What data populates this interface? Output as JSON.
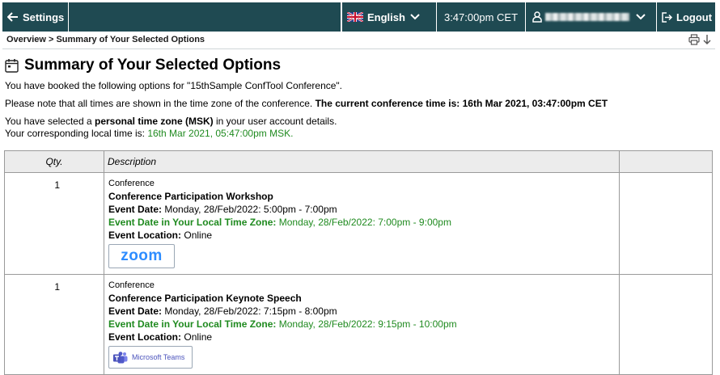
{
  "topbar": {
    "settings_label": "Settings",
    "language_label": "English",
    "time_label": "3:47:00pm CET",
    "logout_label": "Logout"
  },
  "breadcrumb": {
    "text": "Overview > Summary of Your Selected Options"
  },
  "page": {
    "title": "Summary of Your Selected Options",
    "line1": "You have booked the following options for \"15thSample ConfTool Conference\".",
    "line2_prefix": "Please note that all times are shown in the time zone of the conference. ",
    "line2_bold": "The current conference time is: 16th Mar 2021, 03:47:00pm CET",
    "line3_prefix": "You have selected a ",
    "line3_bold": "personal time zone (MSK)",
    "line3_suffix": " in your user account details.",
    "line4_prefix": "Your corresponding local time is: ",
    "line4_value": "16th Mar 2021, 05:47:00pm MSK."
  },
  "table": {
    "headers": [
      "Qty.",
      "Description",
      ""
    ],
    "rows": [
      {
        "qty": "1",
        "category": "Conference",
        "name": "Conference Participation Workshop",
        "event_date_label": "Event Date:",
        "event_date": "Monday, 28/Feb/2022: 5:00pm - 7:00pm",
        "local_label": "Event Date in Your Local Time Zone:",
        "local_date": "Monday, 28/Feb/2022: 7:00pm - 9:00pm",
        "location_label": "Event Location:",
        "location": "Online",
        "logo_text": "zoom"
      },
      {
        "qty": "1",
        "category": "Conference",
        "name": "Conference Participation Keynote Speech",
        "event_date_label": "Event Date:",
        "event_date": "Monday, 28/Feb/2022: 7:15pm - 8:00pm",
        "local_label": "Event Date in Your Local Time Zone:",
        "local_date": "Monday, 28/Feb/2022: 9:15pm - 10:00pm",
        "location_label": "Event Location:",
        "location": "Online",
        "logo_text": "Microsoft Teams"
      }
    ]
  },
  "colors": {
    "topbar": "#1f4a52",
    "green": "#1f8a1f",
    "zoom_blue": "#2d8cff",
    "teams_purple": "#4b53bc"
  }
}
